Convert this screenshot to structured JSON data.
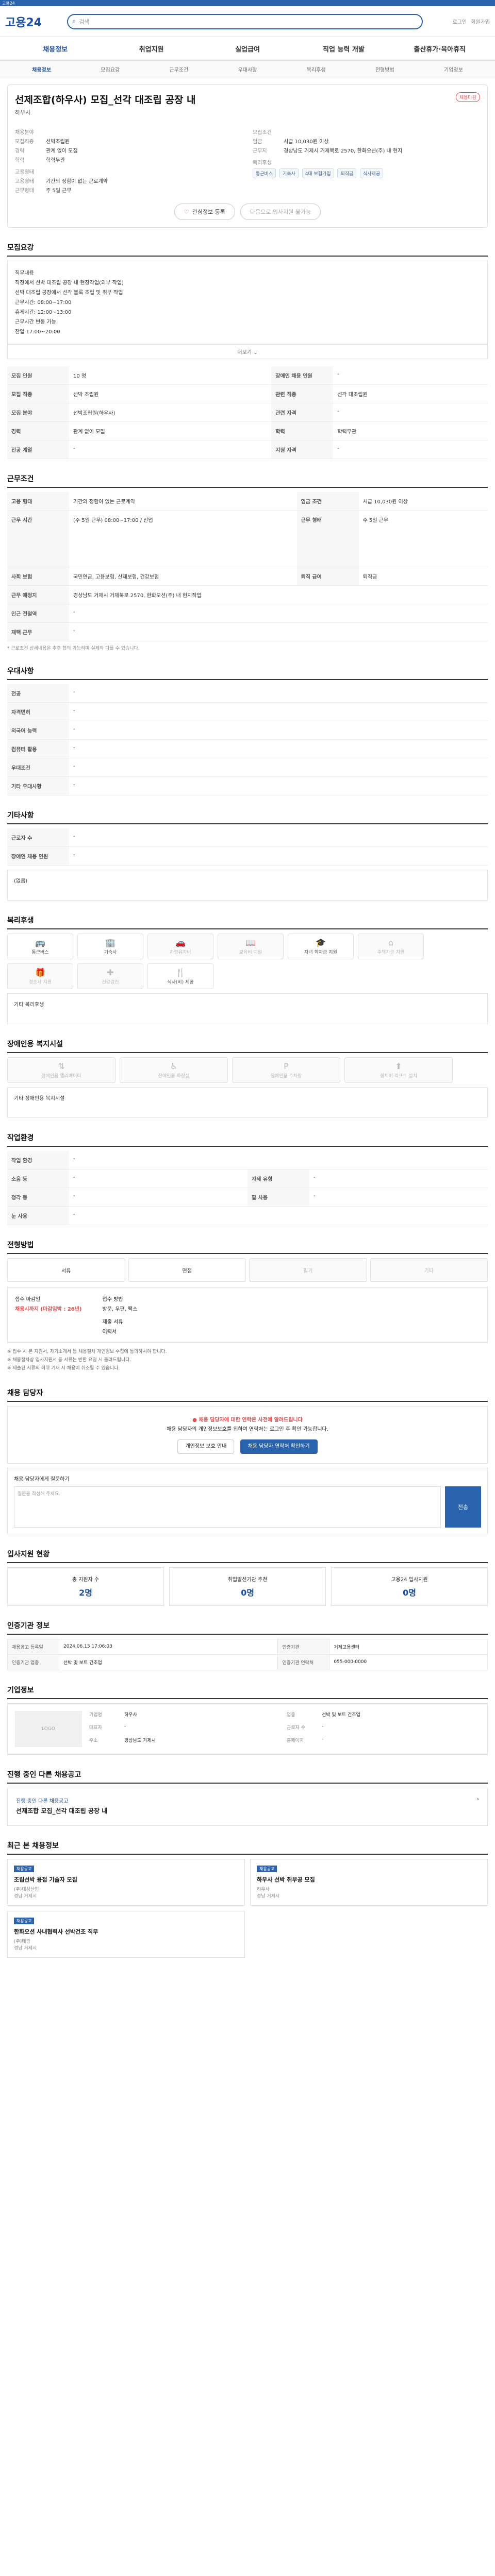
{
  "topbar": {
    "label": "고용24"
  },
  "header": {
    "logo": "고용24",
    "search_placeholder": "검색",
    "util": [
      "로그인",
      "회원가입"
    ]
  },
  "menu": [
    "채용정보",
    "취업지원",
    "실업급여",
    "직업 능력 개발",
    "출산휴가·육아휴직"
  ],
  "subtabs": [
    "채용정보",
    "모집요강",
    "근무조건",
    "우대사항",
    "복리후생",
    "전형방법",
    "기업정보"
  ],
  "job": {
    "title": "선제조합(하우사) 모집_선각 대조립 공장 내",
    "company": "하우사",
    "badge": "채용마감",
    "left": {
      "h1": "채용분야",
      "h2": "근무예정지",
      "rows": [
        [
          "모집직종",
          "선박조립원"
        ],
        [
          "경력",
          "관계 없이 모집"
        ],
        [
          "학력",
          "학력무관"
        ]
      ],
      "h3": "고용형태",
      "rows2": [
        [
          "고용형태",
          "기간의 정함이 없는 근로계약"
        ],
        [
          "근무형태",
          "주 5일 근무"
        ]
      ]
    },
    "right": {
      "h1": "모집조건",
      "rows": [
        [
          "임금",
          "시급 10,030원 이상"
        ],
        [
          "근무지",
          "경상남도 거제시 거제북로 2570, 한화오션(주) 내 현지"
        ]
      ],
      "h2": "복리후생",
      "chips": [
        "통근버스",
        "기숙사",
        "4대 보험가입",
        "퇴직금",
        "식사제공"
      ]
    },
    "buttons": {
      "scrap": "관심정보 등록",
      "apply": "다음으로 입사지원 불가능"
    }
  },
  "sections": {
    "recruit": "모집요강",
    "conditions": "근무조건",
    "preferences": "우대사항",
    "other": "기타사항",
    "benefits": "복리후생",
    "disabled": "장애인용 복지시설",
    "environment": "작업환경",
    "selection": "전형방법",
    "manager": "채용 담당자",
    "stats": "입사지원 현황",
    "registration": "인증기관 정보",
    "company": "기업정보",
    "similar": "진행 중인 다른 채용공고",
    "recent": "최근 본 채용정보"
  },
  "recruit_text": [
    "직무내용",
    "직장에서 선박 대조립 공장 내 현장작업(외부 작업)",
    "선박 대조립 공장에서 선각 블록 조립 및 취부 작업",
    "근무시간: 08:00~17:00",
    "휴게시간: 12:00~13:00",
    "근무시간 변동 가능",
    "잔업 17:00~20:00"
  ],
  "recruit_more": "더보기",
  "recruit_table": [
    [
      "모집 인원",
      "10 명",
      "장애인 채용 인원",
      "-"
    ],
    [
      "모집 직종",
      "선박 조립원",
      "관련 직종",
      "선각 대조립원"
    ],
    [
      "모집 분야",
      "선박조립원(하우사)",
      "관련 자격",
      "-"
    ],
    [
      "경력",
      "관계 없이 모집",
      "학력",
      "학력무관"
    ],
    [
      "전공 계열",
      "-",
      "지원 자격",
      "-"
    ]
  ],
  "conditions_table": [
    [
      "고용 형태",
      "기간의 정함이 없는 근로계약",
      "임금 조건",
      "시급 10,030원 이상"
    ],
    [
      "근무 시간",
      "(주 5일 근무) 08:00~17:00 / 잔업",
      "근무 형태",
      "주 5일 근무"
    ],
    [
      "사회 보험",
      "국민연금, 고용보험, 산재보험, 건강보험",
      "퇴직 급여",
      "퇴직금"
    ],
    [
      "근무 예정지",
      "경상남도 거제시 거제북로 2570, 한화오션(주) 내 현지작업",
      "",
      ""
    ],
    [
      "인근 전철역",
      "-",
      "",
      ""
    ],
    [
      "재택 근무",
      "-",
      "",
      ""
    ]
  ],
  "conditions_note": "* 근로조건 상세내용은 추후 협의 가능하며 실제와 다를 수 있습니다.",
  "preferences_table": [
    [
      "전공",
      "-"
    ],
    [
      "자격면허",
      "-"
    ],
    [
      "외국어 능력",
      "-"
    ],
    [
      "컴퓨터 활용",
      "-"
    ],
    [
      "우대조건",
      "-"
    ],
    [
      "기타 우대사항",
      "-"
    ]
  ],
  "other_table": [
    [
      "근로자 수",
      "-"
    ],
    [
      "장애인 채용 인원",
      "-"
    ]
  ],
  "other_note": "(없음)",
  "benefits": [
    {
      "label": "통근버스",
      "icon": "bus-icon",
      "on": true
    },
    {
      "label": "기숙사",
      "icon": "dorm-icon",
      "on": true
    },
    {
      "label": "차량유지비",
      "icon": "car-icon",
      "on": false
    },
    {
      "label": "교육비 지원",
      "icon": "book-icon",
      "on": false
    },
    {
      "label": "자녀 학자금 지원",
      "icon": "cap-icon",
      "on": true
    },
    {
      "label": "주택자금 지원",
      "icon": "house-icon",
      "on": false
    },
    {
      "label": "경조사 지원",
      "icon": "gift-icon",
      "on": false
    },
    {
      "label": "건강검진",
      "icon": "health-icon",
      "on": false
    },
    {
      "label": "식사(비) 제공",
      "icon": "meal-icon",
      "on": true
    }
  ],
  "benefits_other": "기타 복리후생",
  "disabled_items": [
    "장애인용 엘리베이터",
    "장애인용 화장실",
    "장애인용 주차장",
    "휠체어 리프트 설치"
  ],
  "disabled_other": "기타 장애인용 복지시설",
  "env_table": [
    [
      "작업 환경",
      "-",
      "",
      ""
    ],
    [
      "소음 등",
      "-",
      "자세 유형",
      "-"
    ],
    [
      "청각 등",
      "-",
      "팔 사용",
      "-"
    ],
    [
      "눈 사용",
      "-",
      "",
      ""
    ]
  ],
  "selection_steps": [
    "서류",
    "면접",
    "필기",
    "기타"
  ],
  "apply": {
    "h1": "접수 마감일",
    "deadline": "채용시까지 (마감임박 : 26년)",
    "h2": "접수 방법",
    "method": "방문, 우편, 팩스",
    "h3": "제출 서류",
    "docs": "이력서"
  },
  "apply_notes": [
    "※ 접수 시 본 지원서, 자기소개서 등 채용절차 개인정보 수집에 동의하셔야 합니다.",
    "※ 채용절차상 입사지원서 등 서류는 반환 요청 시 돌려드립니다.",
    "※ 제출된 서류의 허위 기재 시 채용이 취소될 수 있습니다."
  ],
  "manager": {
    "warn": "채용 담당자에 대한 연락은 사전에 알려드립니다",
    "body": "채용 담당자의 개인정보보호를 위하여 연락처는 로그인 후 확인 가능합니다.",
    "btn1": "개인정보 보호 안내",
    "btn2": "채용 담당자 연락처 확인하기"
  },
  "qa": {
    "label": "채용 담당자에게 질문하기",
    "placeholder": "질문을 작성해 주세요.",
    "send": "전송"
  },
  "stats": [
    {
      "label": "총 지원자 수",
      "value": "2명"
    },
    {
      "label": "취업알선기관 추천",
      "value": "0명"
    },
    {
      "label": "고용24 입사지원",
      "value": "0명"
    }
  ],
  "reg_table": [
    [
      "채용공고 등록일",
      "2024.06.13 17:06:03",
      "인증기관",
      "거제고용센터"
    ],
    [
      "인증기관 업종",
      "선박 및 보트 건조업",
      "인증기관 연락처",
      "055-000-0000"
    ]
  ],
  "company": {
    "logo": "LOGO",
    "rows": [
      [
        "기업명",
        "하우사",
        "업종",
        "선박 및 보트 건조업"
      ],
      [
        "대표자",
        "-",
        "근로자 수",
        "-"
      ],
      [
        "주소",
        "경상남도 거제시",
        "홈페이지",
        "-"
      ]
    ]
  },
  "similar": {
    "title": "진행 중인 다른 채용공고",
    "item": "선제조합 모집_선각 대조립 공장 내"
  },
  "recent": [
    {
      "tag": "채용공고",
      "title": "조립선박 용접 기술자 모집",
      "company": "(주)대성산업",
      "loc": "경남 거제시"
    },
    {
      "tag": "채용공고",
      "title": "하우사 선박 취부공 모집",
      "company": "하우사",
      "loc": "경남 거제시"
    },
    {
      "tag": "채용공고",
      "title": "한화오션 사내협력사 선박건조 직무",
      "company": "(주)태광",
      "loc": "경남 거제시"
    }
  ]
}
